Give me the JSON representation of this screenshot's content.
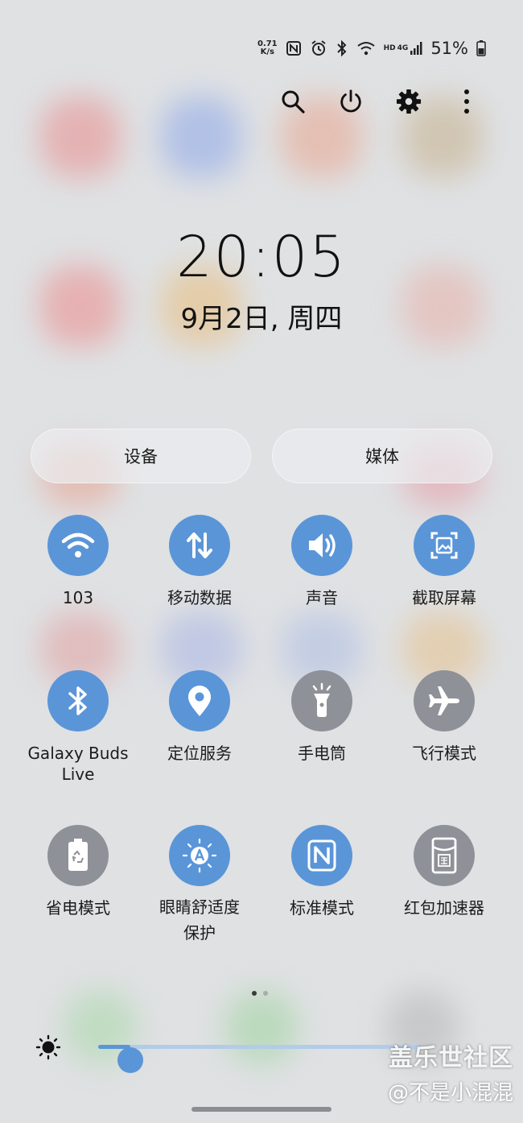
{
  "status_bar": {
    "net_speed_value": "0.71",
    "net_speed_unit": "K/s",
    "nfc_icon": "nfc-icon",
    "alarm_icon": "alarm-icon",
    "bluetooth_icon": "bluetooth-icon",
    "wifi_icon": "wifi-icon",
    "hd_label": "HD",
    "network_label": "4G",
    "battery_percent": "51%"
  },
  "top_actions": [
    "search-icon",
    "power-icon",
    "gear-icon",
    "more-vertical-icon"
  ],
  "clock": {
    "time": "20:05",
    "date": "9月2日, 周四"
  },
  "pills": {
    "devices": "设备",
    "media": "媒体"
  },
  "tiles": [
    {
      "label": "103",
      "icon": "wifi-icon",
      "state": "on"
    },
    {
      "label": "移动数据",
      "icon": "mobile-data-icon",
      "state": "on"
    },
    {
      "label": "声音",
      "icon": "sound-icon",
      "state": "on"
    },
    {
      "label": "截取屏幕",
      "icon": "screenshot-icon",
      "state": "on"
    },
    {
      "label": "Galaxy Buds Live",
      "icon": "bluetooth-icon",
      "state": "on"
    },
    {
      "label": "定位服务",
      "icon": "location-icon",
      "state": "on"
    },
    {
      "label": "手电筒",
      "icon": "flashlight-icon",
      "state": "off"
    },
    {
      "label": "飞行模式",
      "icon": "airplane-icon",
      "state": "off"
    },
    {
      "label": "省电模式",
      "icon": "power-saving-icon",
      "state": "off"
    },
    {
      "label": "眼睛舒适度保护",
      "icon": "eye-comfort-icon",
      "state": "on"
    },
    {
      "label": "标准模式",
      "icon": "nfc-icon",
      "state": "on"
    },
    {
      "label": "红包加速器",
      "icon": "red-packet-icon",
      "state": "off"
    }
  ],
  "pagination": {
    "current": 1,
    "total": 2
  },
  "brightness": {
    "level": 0.1,
    "icon": "sun-icon"
  },
  "watermark": {
    "brand": "盖乐世社区",
    "user": "@不是小混混"
  },
  "colors": {
    "accent": "#5a95d8",
    "tile_off": "#8e9197",
    "background": "#dfe1e3"
  }
}
